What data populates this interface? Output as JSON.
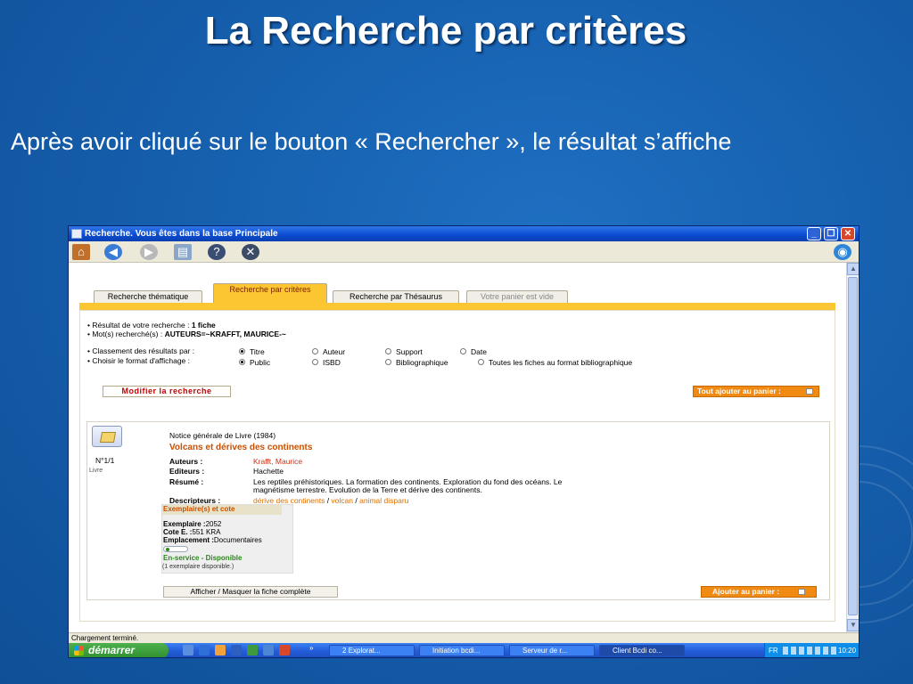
{
  "slide": {
    "title": "La Recherche par critères",
    "text": "Après avoir cliqué sur le bouton « Rechercher », le résultat s’affiche"
  },
  "window": {
    "title": "Recherche. Vous êtes dans la base Principale",
    "status": "Chargement terminé."
  },
  "toolbar": {
    "icons": [
      "home-icon",
      "back-icon",
      "forward-icon",
      "print-icon",
      "help-icon",
      "close-icon",
      "globe-icon"
    ]
  },
  "tabs": [
    {
      "label": "Recherche thématique",
      "state": "normal"
    },
    {
      "label": "Recherche par critères",
      "state": "active"
    },
    {
      "label": "Recherche par Thésaurus",
      "state": "normal"
    },
    {
      "label": "Votre panier est vide",
      "state": "disabled"
    }
  ],
  "summary": {
    "result_prefix": "• Résultat de votre recherche : ",
    "result_count": "1 fiche",
    "keywords_prefix": "• Mot(s) recherché(s) : ",
    "keywords": "AUTEURS=~KRAFFT, MAURICE-~"
  },
  "sort": {
    "label": "• Classement des résultats par :",
    "options": [
      "Titre",
      "Auteur",
      "Support",
      "Date"
    ],
    "selected": "Titre"
  },
  "format": {
    "label": "• Choisir le format d'affichage :",
    "options": [
      "Public",
      "ISBD",
      "Bibliographique",
      "Toutes les fiches au format bibliographique"
    ],
    "selected": "Public"
  },
  "buttons": {
    "modify": "Modifier la recherche",
    "add_all": "Tout ajouter au panier :",
    "toggle_full": "Afficher / Masquer la fiche complète",
    "add_to_cart": "Ajouter au panier :"
  },
  "record": {
    "number": "N°1/1",
    "type": "Livre",
    "header": "Notice générale de Livre  (1984)",
    "title": "Volcans et dérives des continents",
    "authors_label": "Auteurs :",
    "authors": "Krafft, Maurice",
    "publishers_label": "Editeurs :",
    "publishers": "Hachette",
    "summary_label": "Résumé :",
    "summary_line1": "Les reptiles préhistoriques. La formation des continents. Exploration du fond des océans. Le",
    "summary_line2": "magnétisme terrestre. Evolution de la Terre et dérive des continents.",
    "descriptors_label": "Descripteurs :",
    "descriptors": [
      "dérive des continents",
      "volcan",
      "animal disparu"
    ],
    "descriptor_sep": " / "
  },
  "copies": {
    "header": "Exemplaire(s) et cote",
    "copy_label": "Exemplaire :",
    "copy_value": "2052",
    "call_label": "Cote E. :",
    "call_value": "551 KRA",
    "location_label": "Emplacement :",
    "location_value": "Documentaires",
    "status": "En-service - Disponible",
    "availability": "(1 exemplaire disponible.)"
  },
  "taskbar": {
    "start": "démarrer",
    "tasks": [
      "2 Explorat...",
      "Initiation bcdi...",
      "Serveur de r...",
      "Client Bcdi co..."
    ],
    "active_task": "Client Bcdi co...",
    "lang": "FR",
    "clock": "10:20"
  },
  "colors": {
    "slide_bg": "#1660ae",
    "tab_active": "#fcc633",
    "title_orange": "#c85000",
    "link_orange": "#e07000",
    "button_orange": "#f08a12",
    "status_green": "#2a8a1a",
    "modify_red": "#c00000"
  }
}
